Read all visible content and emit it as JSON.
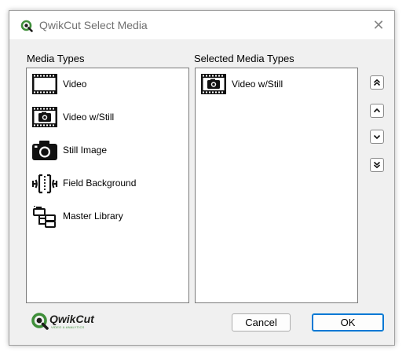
{
  "window": {
    "title": "QwikCut Select Media",
    "close_glyph": "✕"
  },
  "media_types": {
    "label": "Media Types",
    "items": [
      {
        "label": "Video",
        "icon": "film-icon"
      },
      {
        "label": "Video w/Still",
        "icon": "film-camera-icon"
      },
      {
        "label": "Still Image",
        "icon": "camera-icon"
      },
      {
        "label": "Field Background",
        "icon": "field-icon"
      },
      {
        "label": "Master Library",
        "icon": "folder-tree-icon"
      }
    ]
  },
  "selected_media_types": {
    "label": "Selected Media Types",
    "items": [
      {
        "label": "Video w/Still",
        "icon": "film-camera-icon"
      }
    ]
  },
  "order_buttons": {
    "move_top": "chevrons-up-icon",
    "move_up": "chevron-up-icon",
    "move_down": "chevron-down-icon",
    "move_bottom": "chevrons-down-icon"
  },
  "buttons": {
    "cancel": "Cancel",
    "ok": "OK"
  },
  "footer_logo": {
    "name": "QwikCut",
    "tagline": "VIDEO & ANALYTICS"
  },
  "colors": {
    "brand_green": "#3f8f3a",
    "accent_blue": "#0078d4"
  }
}
